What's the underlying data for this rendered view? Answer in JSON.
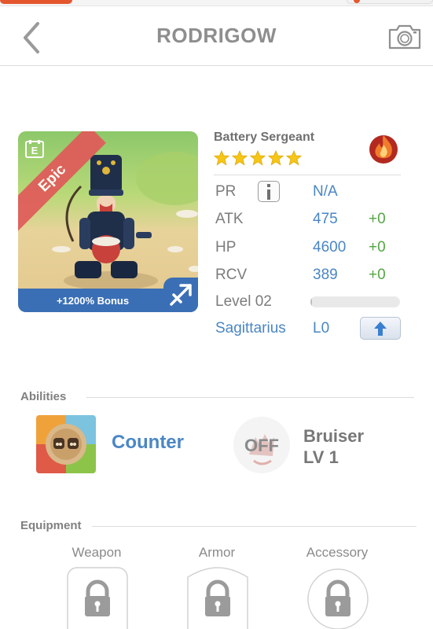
{
  "header": {
    "title": "RODRIGOW",
    "back_icon": "chevron-left-icon",
    "camera_icon": "camera-icon"
  },
  "card": {
    "rarity": "Epic",
    "bonus": "+1200% Bonus",
    "element_badge": "E",
    "zodiac_icon": "sagittarius-arrow-icon",
    "colors": {
      "rarity_ribbon": "#e05a5a",
      "bonus_bar": "#3a6fb5"
    }
  },
  "hero": {
    "name": "Battery Sergeant",
    "stars": 5,
    "element_icon": "fire-icon"
  },
  "stats": {
    "pr_label": "PR",
    "pr_value": "N/A",
    "atk_label": "ATK",
    "atk_value": "475",
    "atk_delta": "+0",
    "hp_label": "HP",
    "hp_value": "4600",
    "hp_delta": "+0",
    "rcv_label": "RCV",
    "rcv_value": "389",
    "rcv_delta": "+0",
    "level_label": "Level 02",
    "level_progress": 0.02,
    "zodiac": "Sagittarius",
    "zodiac_level": "L0"
  },
  "abilities": {
    "title": "Abilities",
    "active": {
      "name": "Counter",
      "icon": "counter-ability-icon"
    },
    "passive": {
      "status": "OFF",
      "name_line1": "Bruiser",
      "name_line2": "LV 1",
      "icon": "bruiser-ability-icon"
    }
  },
  "equipment": {
    "title": "Equipment",
    "slots": [
      {
        "label": "Weapon",
        "icon": "lock-icon"
      },
      {
        "label": "Armor",
        "icon": "lock-icon"
      },
      {
        "label": "Accessory",
        "icon": "lock-icon"
      }
    ]
  },
  "colors": {
    "accent_blue": "#4a86c5",
    "delta_green": "#55a546",
    "star_gold": "#f5c518"
  }
}
